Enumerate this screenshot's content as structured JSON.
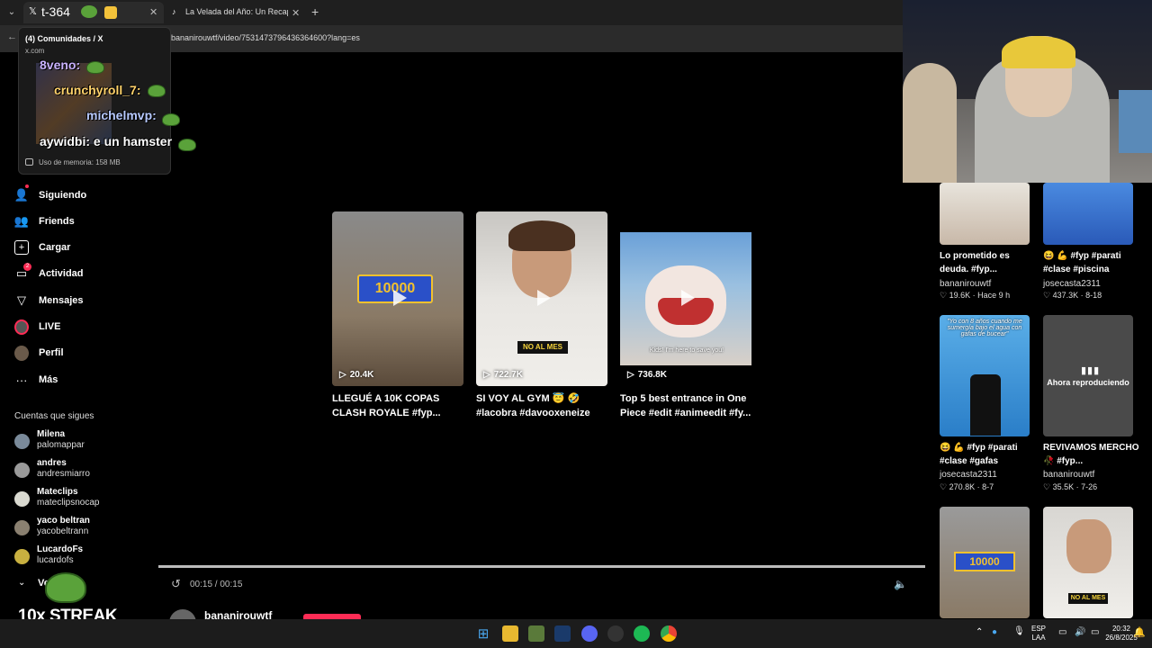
{
  "browser": {
    "tabs": [
      {
        "label": "t-364",
        "favicon": "x-logo-icon"
      },
      {
        "label": "La Velada del Año: Un Recap de",
        "favicon": "tiktok-icon"
      }
    ],
    "url": "bananirouwtf/video/7531473796436364600?lang=es"
  },
  "tab_preview": {
    "title": "(4) Comunidades / X",
    "domain": "x.com",
    "memory": "Uso de memoria: 158 MB"
  },
  "chat_overlay": {
    "lines": [
      "8veno:",
      "crunchyroll_7:",
      "michelmvp:",
      "aywidbi: e un hamster"
    ]
  },
  "sidebar": {
    "items": [
      {
        "label": "Siguiendo",
        "icon": "following-icon"
      },
      {
        "label": "Friends",
        "icon": "friends-icon"
      },
      {
        "label": "Cargar",
        "icon": "upload-icon"
      },
      {
        "label": "Actividad",
        "icon": "activity-icon",
        "badge": "2"
      },
      {
        "label": "Mensajes",
        "icon": "messages-icon"
      },
      {
        "label": "LIVE",
        "icon": "live-icon"
      },
      {
        "label": "Perfil",
        "icon": "profile-icon"
      },
      {
        "label": "Más",
        "icon": "more-icon"
      }
    ],
    "following_title": "Cuentas que sigues",
    "following": [
      {
        "name": "Milena",
        "handle": "palomappar"
      },
      {
        "name": "andres",
        "handle": "andresmiarro"
      },
      {
        "name": "Mateclips",
        "handle": "mateclipsnocap"
      },
      {
        "name": "yaco beltran",
        "handle": "yacobeltrann"
      },
      {
        "name": "LucardoFs",
        "handle": "lucardofs"
      }
    ],
    "see_more": "Ve",
    "streak": "10x STREAK"
  },
  "grid": {
    "cards": [
      {
        "views": "20.4K",
        "title": "LLEGUÉ A 10K COPAS CLASH ROYALE #fyp...",
        "overlay": "10000",
        "bg": "#8a7a66"
      },
      {
        "views": "722.7K",
        "title": "SI VOY AL GYM 😇 🤣 #lacobra #davooxeneize",
        "overlay": "NO AL MES",
        "bg": "#d8d6d2"
      },
      {
        "views": "736.8K",
        "title": "Top 5 best entrance in One Piece #edit #animeedit #fy...",
        "overlay": "Kids! I'm here to save you!",
        "bg": "#6aa0d8"
      }
    ]
  },
  "player": {
    "time": "00:15 / 00:15",
    "progress": 1.0,
    "author": "bananirouwtf"
  },
  "right_column": {
    "videos": [
      {
        "title": "Lo prometido es deuda. #fyp...",
        "author": "bananirouwtf",
        "likes": "19.6K",
        "date": "Hace 9 h"
      },
      {
        "title": "😆 💪 #fyp #parati #clase #piscina",
        "author": "josecasta2311",
        "likes": "437.3K",
        "date": "8-18"
      },
      {
        "title": "😆 💪 #fyp #parati #clase #gafas",
        "author": "josecasta2311",
        "likes": "270.8K",
        "date": "8-7",
        "overlay": "\"Yo con 8 años cuando me sumergía bajo el agua con gafas de bucear\""
      },
      {
        "title": "REVIVAMOS MERCHO 🥀 #fyp...",
        "author": "bananirouwtf",
        "likes": "35.5K",
        "date": "7-26",
        "now_playing": "Ahora reproduciendo"
      },
      {
        "overlay": "10000"
      },
      {
        "overlay": "NO AL MES"
      }
    ]
  },
  "taskbar": {
    "lang": "ESP",
    "region": "LAA",
    "time": "20:32",
    "date": "26/8/2025"
  },
  "colors": {
    "accent": "#fe2c55",
    "background": "#000000"
  }
}
